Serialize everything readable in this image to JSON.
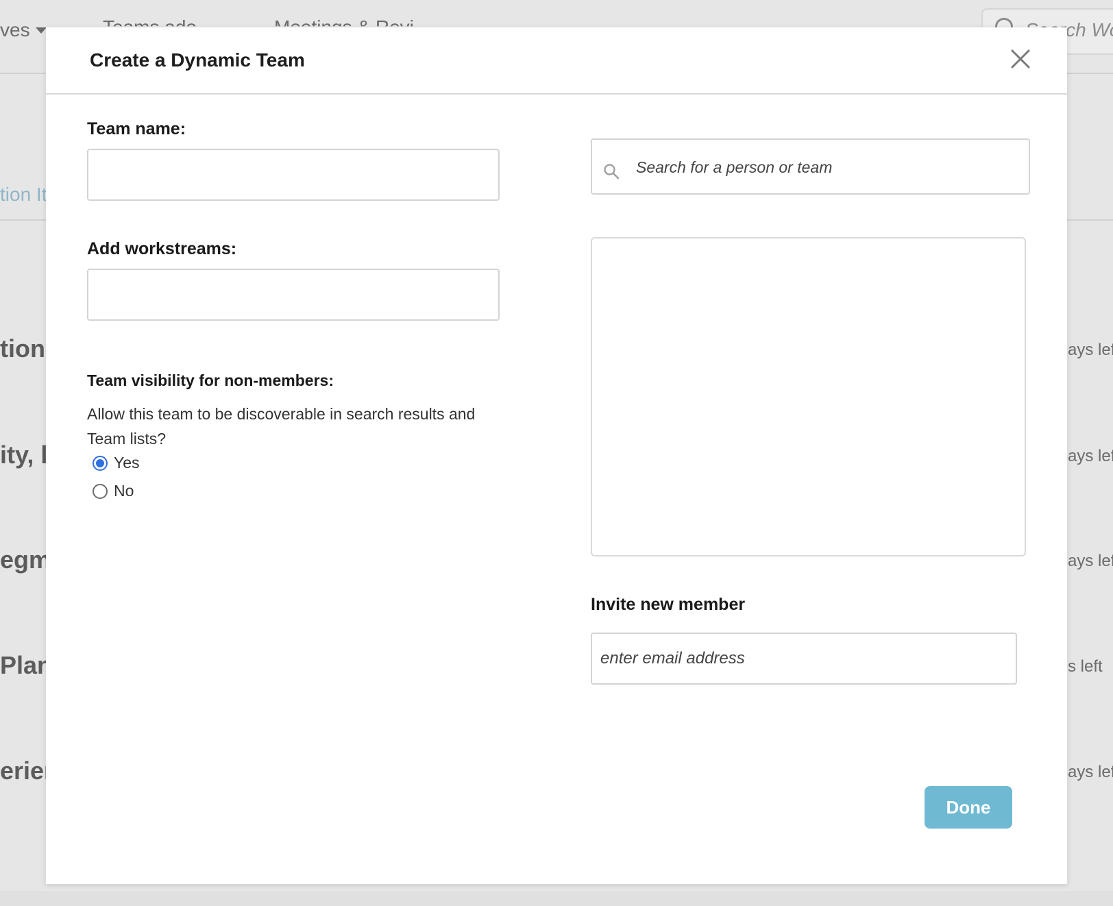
{
  "background": {
    "nav_items": [
      "ves",
      "Teams ado",
      "Meetings & Revi"
    ],
    "search_placeholder": "Search Wo",
    "link_text": "tion It",
    "rows": [
      {
        "title": "tiona",
        "meta": "ays lef"
      },
      {
        "title": "ity, l",
        "meta": "ays lef"
      },
      {
        "title": "egm",
        "meta": "ays lef"
      },
      {
        "title": "Plan",
        "meta": "s left"
      },
      {
        "title": "erien",
        "meta": "ays lef"
      }
    ]
  },
  "modal": {
    "title": "Create a Dynamic Team",
    "close_icon": "close-icon",
    "team_name_label": "Team name:",
    "team_name_value": "",
    "workstreams_label": "Add workstreams:",
    "workstreams_value": "",
    "visibility_label": "Team visibility for non-members:",
    "visibility_question": "Allow this team to be discoverable in search results and Team lists?",
    "options": [
      {
        "label": "Yes",
        "selected": true
      },
      {
        "label": "No",
        "selected": false
      }
    ],
    "search_placeholder": "Search for a person or team",
    "invite_label": "Invite new member",
    "invite_placeholder": "enter email address",
    "done_label": "Done"
  },
  "colors": {
    "accent": "#6fb9d3",
    "radio_selected": "#2f6fe0",
    "overlay_bg": "#e6e6e6"
  }
}
